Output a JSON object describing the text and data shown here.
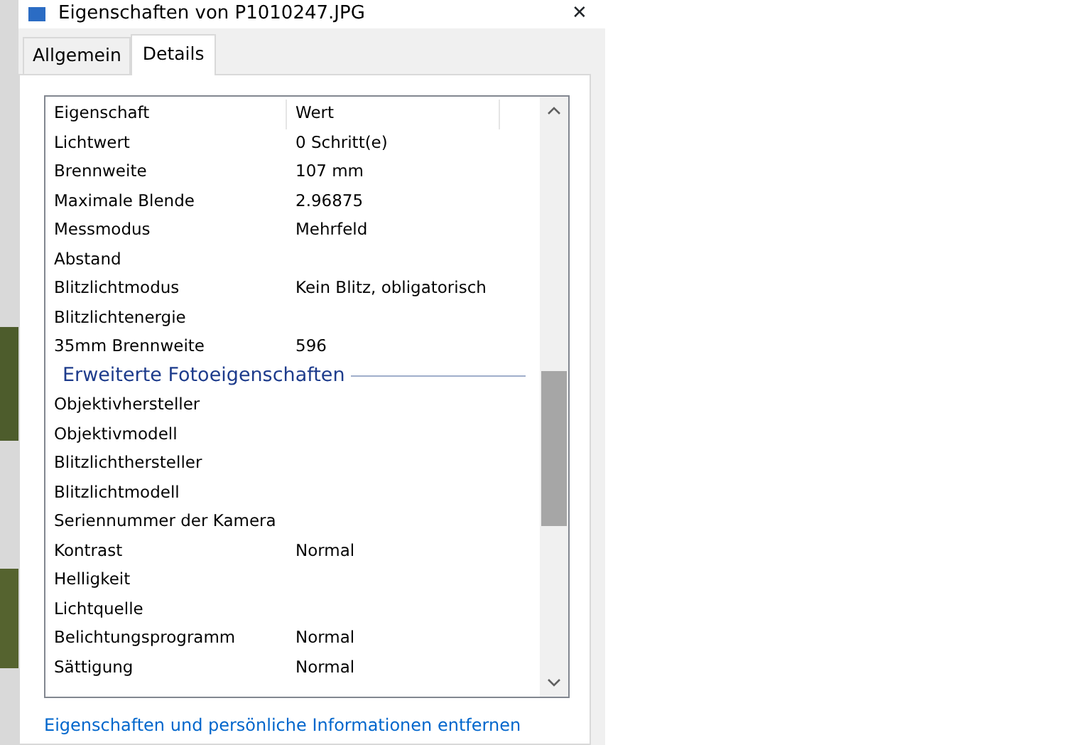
{
  "window": {
    "title": "Eigenschaften von P1010247.JPG",
    "close": "✕"
  },
  "tabs": [
    {
      "label": "Allgemein",
      "selected": false
    },
    {
      "label": "Details",
      "selected": true
    }
  ],
  "table": {
    "columns": [
      "Eigenschaft",
      "Wert"
    ],
    "rows": [
      {
        "kind": "row",
        "name": "Lichtwert",
        "value": "0 Schritt(e)"
      },
      {
        "kind": "row",
        "name": "Brennweite",
        "value": "107 mm"
      },
      {
        "kind": "row",
        "name": "Maximale Blende",
        "value": "2.96875"
      },
      {
        "kind": "row",
        "name": "Messmodus",
        "value": "Mehrfeld"
      },
      {
        "kind": "row",
        "name": "Abstand",
        "value": ""
      },
      {
        "kind": "row",
        "name": "Blitzlichtmodus",
        "value": "Kein Blitz, obligatorisch"
      },
      {
        "kind": "row",
        "name": "Blitzlichtenergie",
        "value": ""
      },
      {
        "kind": "row",
        "name": "35mm Brennweite",
        "value": "596"
      },
      {
        "kind": "group",
        "name": "Erweiterte Fotoeigenschaften"
      },
      {
        "kind": "row",
        "name": "Objektivhersteller",
        "value": ""
      },
      {
        "kind": "row",
        "name": "Objektivmodell",
        "value": ""
      },
      {
        "kind": "row",
        "name": "Blitzlichthersteller",
        "value": ""
      },
      {
        "kind": "row",
        "name": "Blitzlichtmodell",
        "value": ""
      },
      {
        "kind": "row",
        "name": "Seriennummer der Kamera",
        "value": ""
      },
      {
        "kind": "row",
        "name": "Kontrast",
        "value": "Normal"
      },
      {
        "kind": "row",
        "name": "Helligkeit",
        "value": ""
      },
      {
        "kind": "row",
        "name": "Lichtquelle",
        "value": ""
      },
      {
        "kind": "row",
        "name": "Belichtungsprogramm",
        "value": "Normal"
      },
      {
        "kind": "row",
        "name": "Sättigung",
        "value": "Normal"
      }
    ]
  },
  "link": "Eigenschaften und persönliche Informationen entfernen"
}
